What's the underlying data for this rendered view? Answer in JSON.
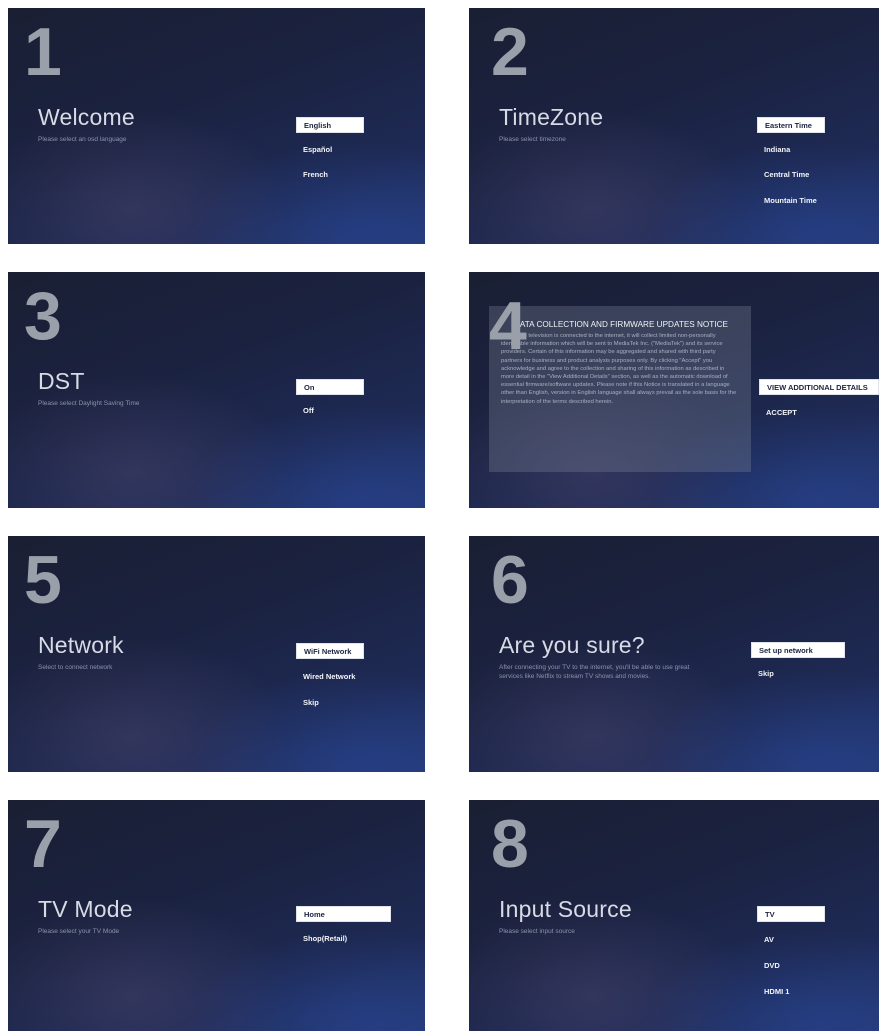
{
  "screens": [
    {
      "number": "1",
      "title": "Welcome",
      "subtitle": "Please select an osd language",
      "options": [
        "English",
        "Español",
        "French"
      ]
    },
    {
      "number": "2",
      "title": "TimeZone",
      "subtitle": "Please select timezone",
      "options": [
        "Eastern Time",
        "Indiana",
        "Central Time",
        "Mountain Time"
      ]
    },
    {
      "number": "3",
      "title": "DST",
      "subtitle": "Please select Daylight Saving Time",
      "options": [
        "On",
        "Off"
      ]
    },
    {
      "number": "4",
      "notice_title": "DATA COLLECTION AND FIRMWARE UPDATES NOTICE",
      "notice_body": "When this television is connected to the internet, it will collect limited non-personally identifiable information which will be sent to MediaTek Inc. (\"MediaTek\") and its service providers. Certain of this information may be aggregated and shared with third party partners for business and product analysis purposes only. By clicking \"Accept\" you acknowledge and agree to the collection and sharing of this information as described in more detail in the \"View Additional Details\" section, as well as the automatic download of essential firmware/software updates. Please note if this Notice is translated in a language other than English, version in English language shall always prevail as the sole basis for the interpretation of the terms described herein.",
      "options": [
        "VIEW ADDITIONAL DETAILS",
        "ACCEPT"
      ]
    },
    {
      "number": "5",
      "title": "Network",
      "subtitle": "Select to connect network",
      "options": [
        "WiFi Network",
        "Wired Network",
        "Skip"
      ]
    },
    {
      "number": "6",
      "title": "Are you sure?",
      "subtitle": "After connecting your TV to the internet, you'll be able to use great services like Netflix to stream TV shows and movies.",
      "options": [
        "Set up network",
        "Skip"
      ]
    },
    {
      "number": "7",
      "title": "TV Mode",
      "subtitle": "Please select your TV Mode",
      "options": [
        "Home",
        "Shop(Retail)"
      ]
    },
    {
      "number": "8",
      "title": "Input Source",
      "subtitle": "Please select input source",
      "options": [
        "TV",
        "AV",
        "DVD",
        "HDMI 1"
      ]
    }
  ]
}
